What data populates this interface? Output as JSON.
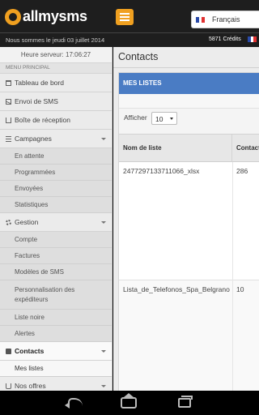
{
  "app": {
    "logo_text": "allmysms",
    "brand_color": "#f0a020"
  },
  "topbar": {
    "menu_button": "hamburger-icon",
    "language": "Français"
  },
  "infobar": {
    "date": "Nous sommes le jeudi 03 juillet 2014",
    "credits": "5871 Crédits"
  },
  "sidebar": {
    "server_time": "Heure serveur: 17:06:27",
    "section_title": "MENU PRINCIPAL",
    "items": [
      {
        "label": "Tableau de bord",
        "icon": "dashboard-icon"
      },
      {
        "label": "Envoi de SMS",
        "icon": "envelope-icon"
      },
      {
        "label": "Boîte de réception",
        "icon": "inbox-icon"
      },
      {
        "label": "Campagnes",
        "icon": "list-icon",
        "expanded": true,
        "children": [
          "En attente",
          "Programmées",
          "Envoyées",
          "Statistiques"
        ]
      },
      {
        "label": "Gestion",
        "icon": "gear-icon",
        "expanded": true,
        "children": [
          "Compte",
          "Factures",
          "Modèles de SMS",
          "Personnalisation des expéditeurs",
          "Liste noire",
          "Alertes"
        ]
      },
      {
        "label": "Contacts",
        "icon": "book-icon",
        "active": true,
        "children": [
          "Mes listes"
        ]
      },
      {
        "label": "Nos offres",
        "icon": "cart-icon"
      }
    ]
  },
  "main": {
    "title": "Contacts",
    "panel_title": "MES LISTES",
    "show_label": "Afficher",
    "show_value": "10",
    "table": {
      "columns": [
        "Nom de liste",
        "Contact"
      ],
      "rows": [
        [
          "2477297133711066_xlsx",
          "286"
        ],
        [
          "Lista_de_Telefonos_Spa_Belgrano",
          "10"
        ]
      ]
    }
  }
}
